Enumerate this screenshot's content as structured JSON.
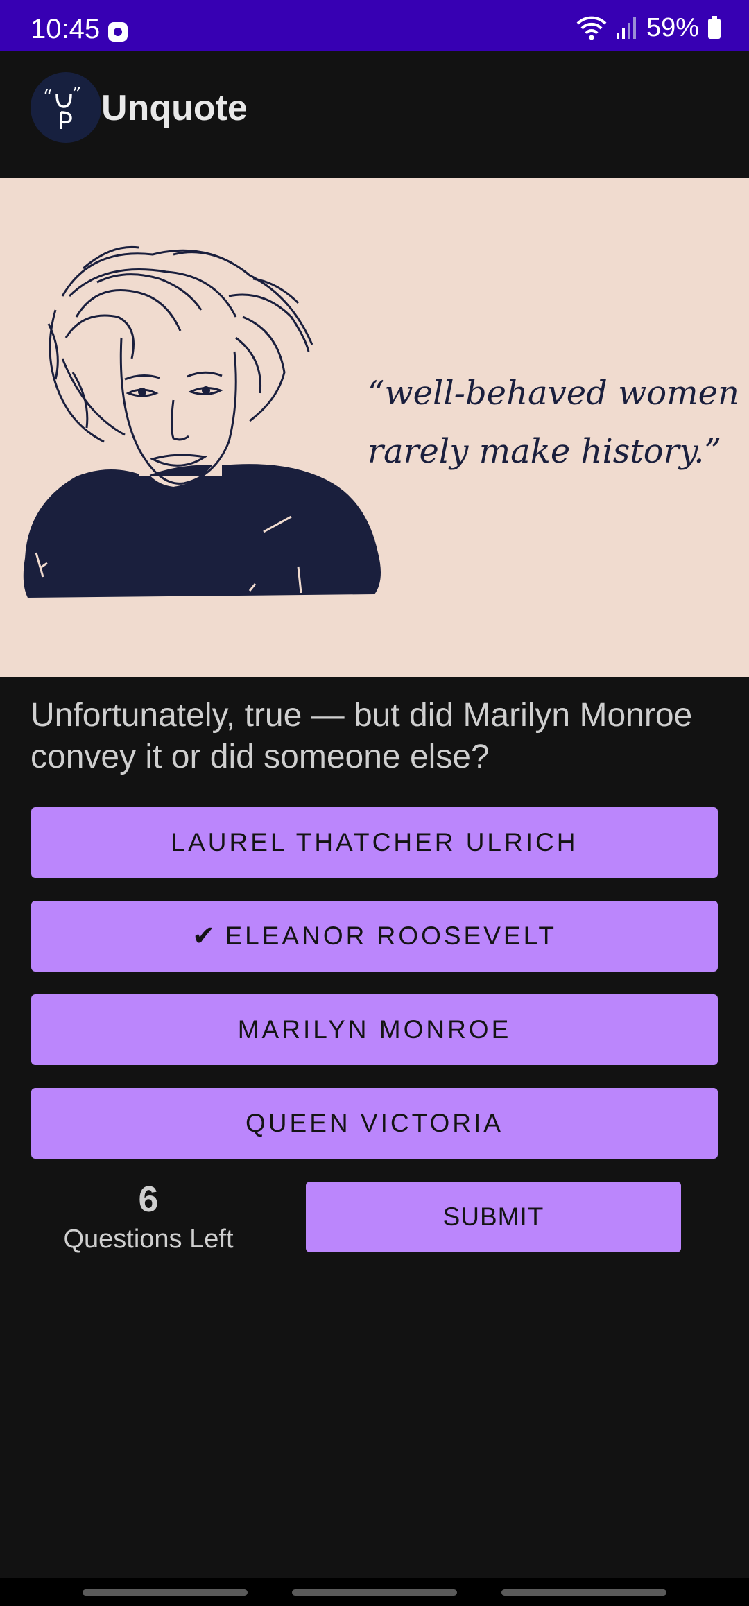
{
  "status_bar": {
    "time": "10:45",
    "battery": "59%",
    "icons": [
      "game-icon",
      "wifi-icon",
      "signal-icon",
      "battery-icon"
    ]
  },
  "app": {
    "title": "Unquote",
    "logo_icon": "unquote-logo-icon"
  },
  "hero": {
    "quote_lines": [
      "“well-behaved women",
      "rarely make history.”"
    ],
    "illustration": "marilyn-monroe-portrait"
  },
  "question": "Unfortunately, true — but did Marilyn Monroe convey it or did someone else?",
  "answers": [
    {
      "label": "LAUREL THATCHER ULRICH",
      "selected": false
    },
    {
      "label": "ELEANOR ROOSEVELT",
      "selected": true,
      "mark": "✔"
    },
    {
      "label": "MARILYN MONROE",
      "selected": false
    },
    {
      "label": "QUEEN VICTORIA",
      "selected": false
    }
  ],
  "counter": {
    "value": "6",
    "label": "Questions Left"
  },
  "submit_label": "SUBMIT",
  "colors": {
    "status_bar": "#3700b3",
    "background": "#121212",
    "accent": "#bb86fc",
    "hero_bg": "#f0dbcf",
    "ink": "#1a1f3d"
  }
}
